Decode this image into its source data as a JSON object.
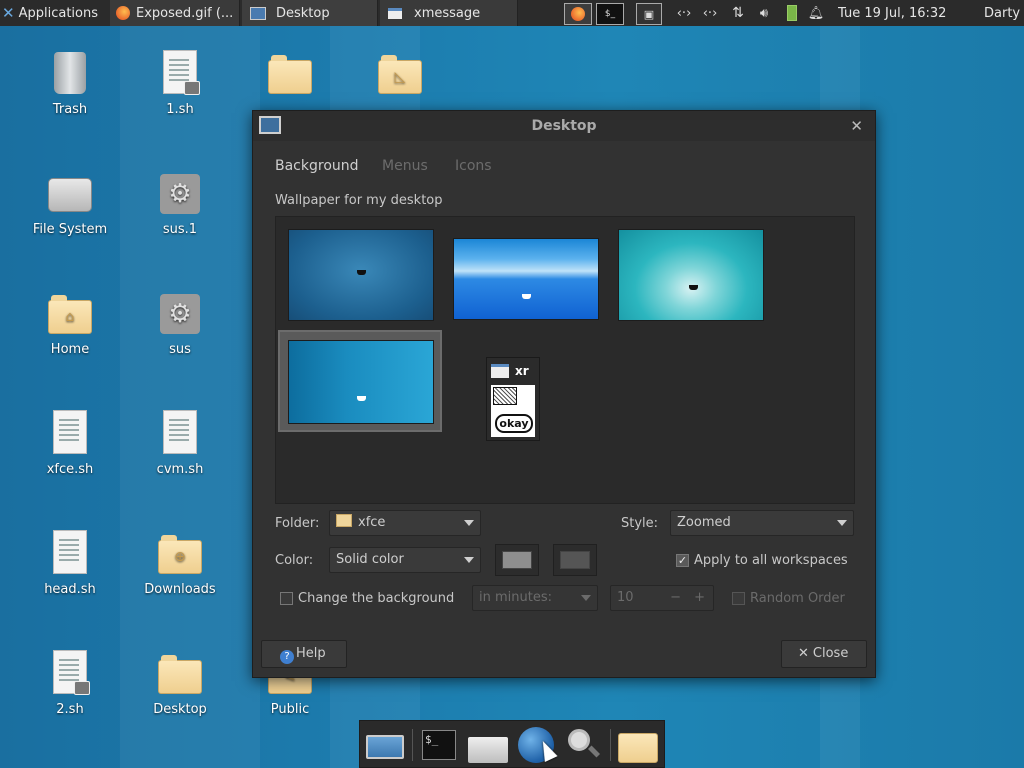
{
  "top_panel": {
    "applications_label": "Applications",
    "tasks": [
      {
        "label": "Exposed.gif (..."
      },
      {
        "label": "Desktop"
      },
      {
        "label": "xmessage"
      }
    ],
    "clock": "Tue 19 Jul, 16:32",
    "user": "Darty uwu"
  },
  "desktop_icons": [
    {
      "label": "Trash"
    },
    {
      "label": "1.sh"
    },
    {
      "label": "File System"
    },
    {
      "label": "sus.1"
    },
    {
      "label": "Home"
    },
    {
      "label": "sus"
    },
    {
      "label": "xfce.sh"
    },
    {
      "label": "cvm.sh"
    },
    {
      "label": "head.sh"
    },
    {
      "label": "Downloads"
    },
    {
      "label": "2.sh"
    },
    {
      "label": "Desktop"
    },
    {
      "label": "Public"
    }
  ],
  "dialog": {
    "title": "Desktop",
    "tabs": [
      {
        "label": "Background",
        "active": true
      },
      {
        "label": "Menus",
        "active": false
      },
      {
        "label": "Icons",
        "active": false
      }
    ],
    "wallpaper_label": "Wallpaper for my desktop",
    "xmessage": {
      "title": "xr",
      "button": "okay"
    },
    "folder_label": "Folder:",
    "folder_value": "xfce",
    "style_label": "Style:",
    "style_value": "Zoomed",
    "color_label": "Color:",
    "color_value": "Solid color",
    "apply_all_label": "Apply to all workspaces",
    "apply_all_checked": true,
    "change_bg_label": "Change the background",
    "change_bg_checked": false,
    "interval_unit": "in minutes:",
    "interval_value": "10",
    "random_order_label": "Random Order",
    "help_button": "Help",
    "close_button": "Close"
  },
  "colors": {
    "panel_bg": "#2b2b2b",
    "dialog_bg": "#323232",
    "desktop_blue": "#1c7cae"
  }
}
